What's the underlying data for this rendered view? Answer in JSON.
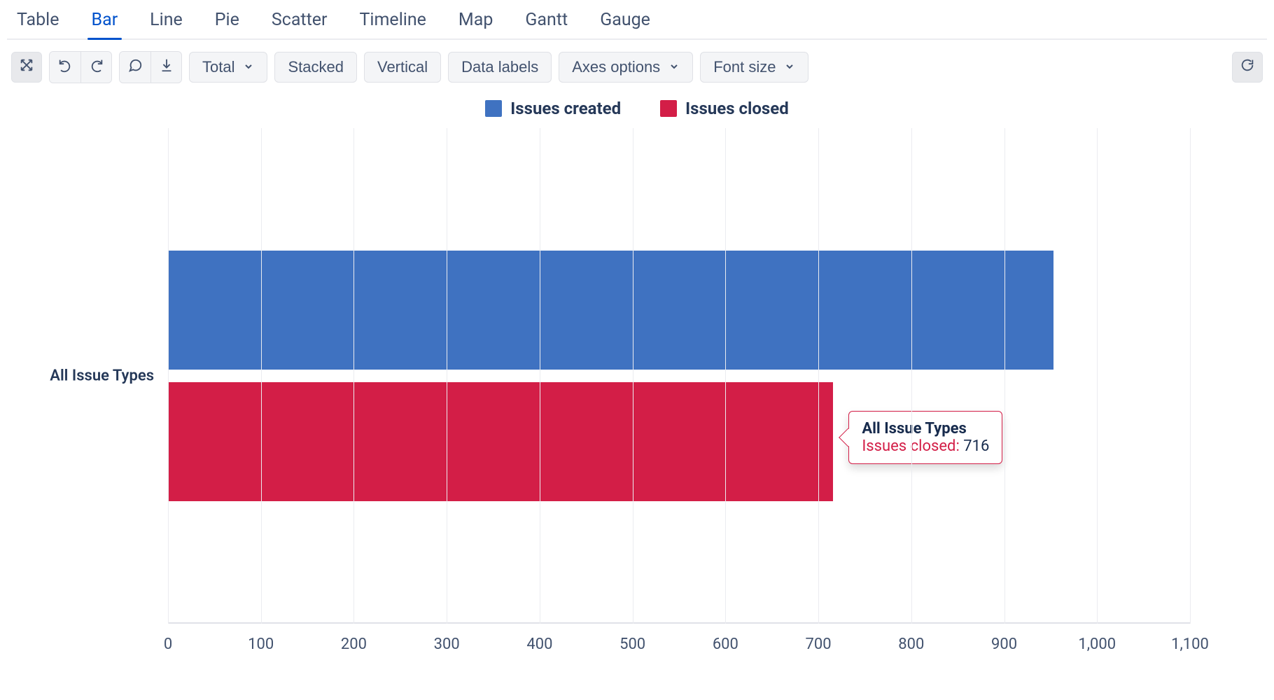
{
  "tabs": [
    "Table",
    "Bar",
    "Line",
    "Pie",
    "Scatter",
    "Timeline",
    "Map",
    "Gantt",
    "Gauge"
  ],
  "active_tab": "Bar",
  "toolbar": {
    "total_label": "Total",
    "stacked_label": "Stacked",
    "vertical_label": "Vertical",
    "data_labels_label": "Data labels",
    "axes_options_label": "Axes options",
    "font_size_label": "Font size"
  },
  "legend": {
    "created": {
      "label": "Issues created",
      "color": "#3f72c1"
    },
    "closed": {
      "label": "Issues closed",
      "color": "#d31e47"
    }
  },
  "chart_data": {
    "type": "bar",
    "orientation": "horizontal",
    "categories": [
      "All Issue Types"
    ],
    "series": [
      {
        "name": "Issues created",
        "color": "#3f72c1",
        "values": [
          953
        ]
      },
      {
        "name": "Issues closed",
        "color": "#d31e47",
        "values": [
          716
        ]
      }
    ],
    "xlabel": "",
    "ylabel": "",
    "xlim": [
      0,
      1100
    ],
    "x_ticks": [
      0,
      100,
      200,
      300,
      400,
      500,
      600,
      700,
      800,
      900,
      1000,
      1100
    ]
  },
  "tooltip": {
    "category": "All Issue Types",
    "series_label": "Issues closed:",
    "value": "716"
  }
}
